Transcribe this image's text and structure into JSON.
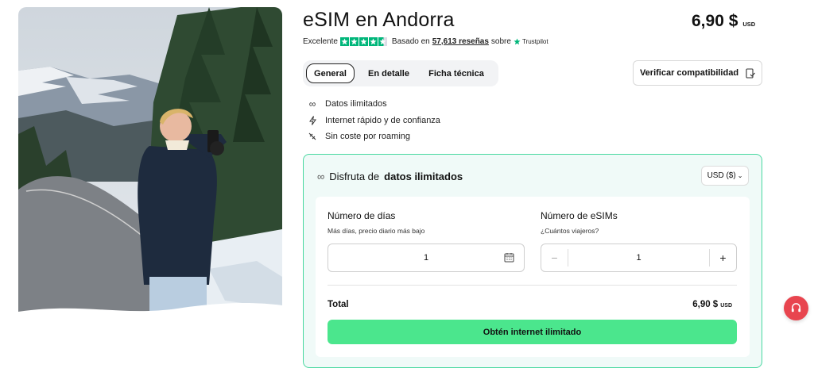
{
  "product": {
    "title": "eSIM en Andorra",
    "price": "6,90 $",
    "currency_code": "USD"
  },
  "rating": {
    "label": "Excelente",
    "based_on": "Basado en",
    "reviews": "57,613 reseñas",
    "on": "sobre",
    "provider": "Trustpilot",
    "stars_value": 4.5,
    "stars_max": 5
  },
  "tabs": [
    {
      "label": "General",
      "active": true
    },
    {
      "label": "En detalle",
      "active": false
    },
    {
      "label": "Ficha técnica",
      "active": false
    }
  ],
  "verify_button": {
    "label": "Verificar compatibilidad",
    "icon": "device-check-icon"
  },
  "features": [
    {
      "icon": "infinity-icon",
      "label": "Datos ilimitados"
    },
    {
      "icon": "lightning-icon",
      "label": "Internet rápido y de confianza"
    },
    {
      "icon": "no-roaming-icon",
      "label": "Sin coste por roaming"
    }
  ],
  "plan": {
    "heading_prefix": "Disfruta de",
    "heading_bold": "datos ilimitados",
    "currency_select": "USD ($)",
    "days_label": "Número de días",
    "days_hint": "Más días, precio diario más bajo",
    "days_value": "1",
    "sims_label": "Número de eSIMs",
    "sims_hint": "¿Cuántos viajeros?",
    "sims_value": "1",
    "total_label": "Total",
    "total_price": "6,90 $",
    "total_currency": "USD",
    "cta_label": "Obtén internet ilimitado"
  },
  "colors": {
    "accent_green": "#4be68d",
    "plan_border": "#48d8a0",
    "plan_bg": "#f0faf8",
    "trustpilot_green": "#00b67a",
    "support_red": "#e8454f"
  }
}
